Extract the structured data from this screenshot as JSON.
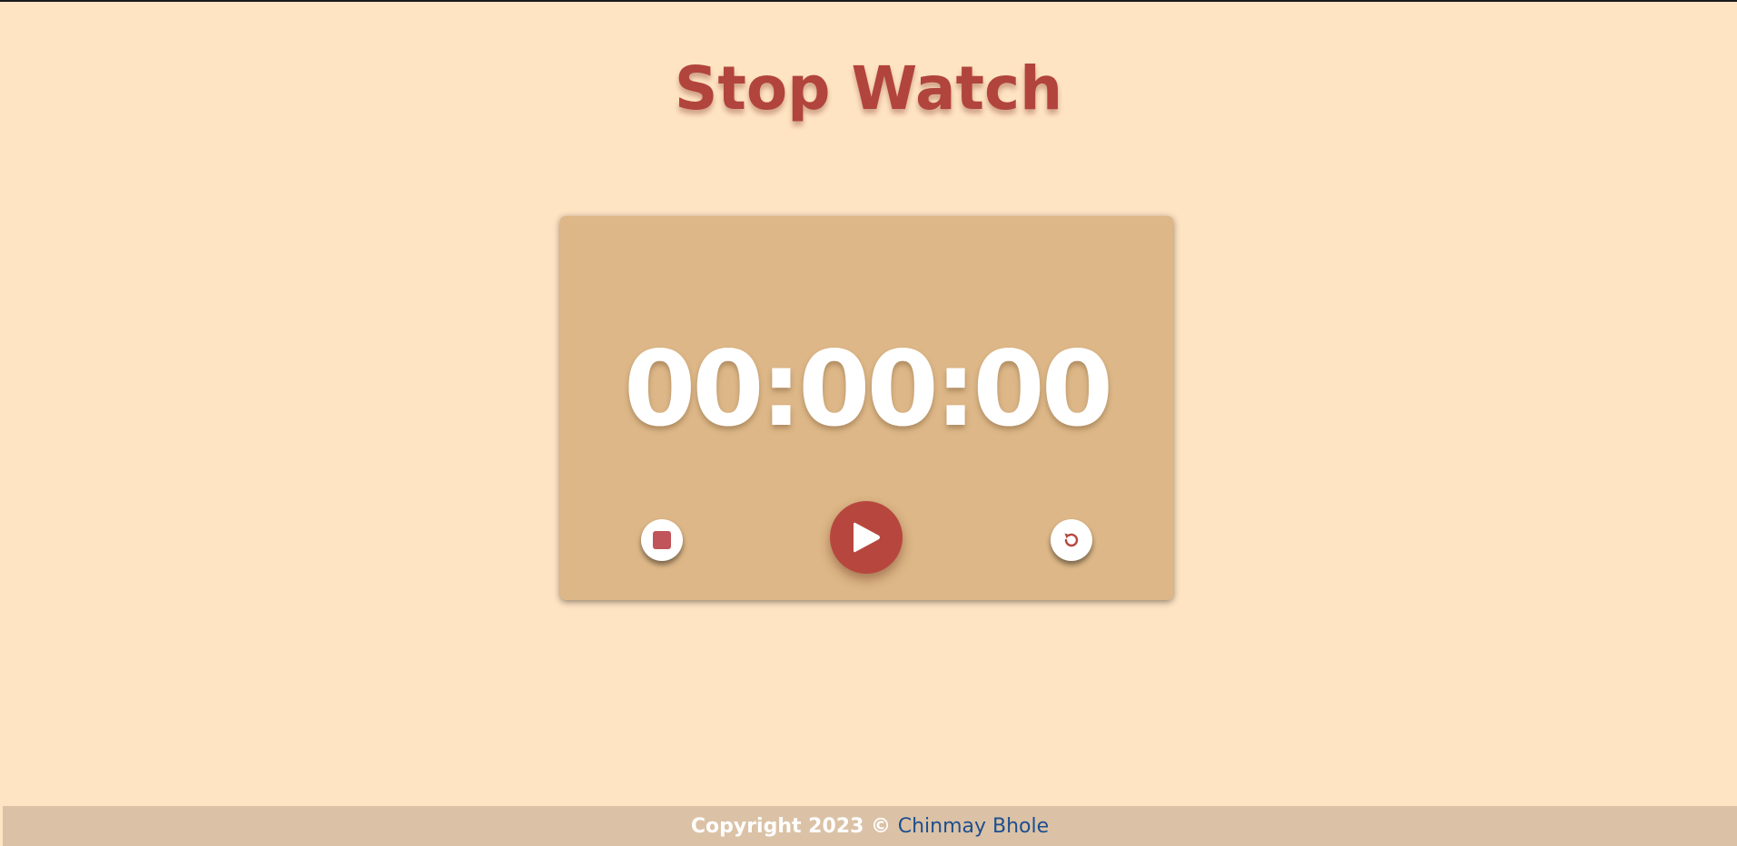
{
  "header": {
    "title": "Stop Watch"
  },
  "stopwatch": {
    "time": "00:00:00",
    "buttons": {
      "stop_icon": "stop-icon",
      "play_icon": "play-icon",
      "reset_icon": "reset-icon"
    }
  },
  "footer": {
    "copyright": "Copyright 2023 © ",
    "author": "Chinmay Bhole"
  },
  "colors": {
    "background": "#ffe4c3",
    "card": "#ddb787",
    "accent": "#b7473e",
    "footer_bg": "#dbc2a6",
    "link": "#1d4e8f"
  }
}
